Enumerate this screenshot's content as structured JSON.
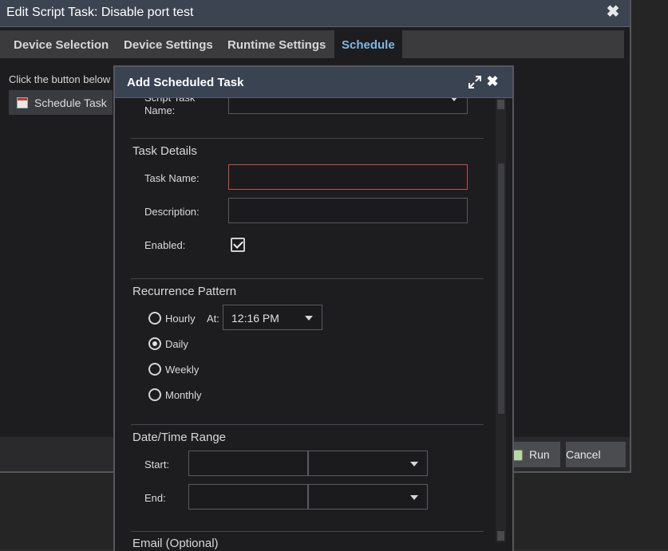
{
  "outer_dialog": {
    "title": "Edit Script Task: Disable port test",
    "close_glyph": "✖",
    "tabs": [
      {
        "label": "Device Selection",
        "active": false
      },
      {
        "label": "Device Settings",
        "active": false
      },
      {
        "label": "Runtime Settings",
        "active": false
      },
      {
        "label": "Schedule",
        "active": true
      }
    ],
    "hint": "Click the button below",
    "schedule_button": "Schedule Task",
    "run_button": "Run",
    "cancel_button": "Cancel"
  },
  "modal": {
    "title": "Add Scheduled Task",
    "close_glyph": "✖",
    "script_task_label": "Script Task Name:",
    "task_details": {
      "heading": "Task Details",
      "task_name_label": "Task Name:",
      "task_name_value": "",
      "description_label": "Description:",
      "description_value": "",
      "enabled_label": "Enabled:",
      "enabled": true
    },
    "recurrence": {
      "heading": "Recurrence Pattern",
      "options": [
        {
          "label": "Hourly",
          "selected": false
        },
        {
          "label": "Daily",
          "selected": true
        },
        {
          "label": "Weekly",
          "selected": false
        },
        {
          "label": "Monthly",
          "selected": false
        }
      ],
      "at_label": "At:",
      "at_value": "12:16 PM"
    },
    "date_range": {
      "heading": "Date/Time Range",
      "start_label": "Start:",
      "end_label": "End:",
      "start_value": "",
      "end_value": ""
    },
    "email_heading": "Email (Optional)"
  },
  "colors": {
    "accent_tab": "#7fb6e6",
    "title_bar": "#3a4351",
    "invalid_border": "#c0504d"
  }
}
